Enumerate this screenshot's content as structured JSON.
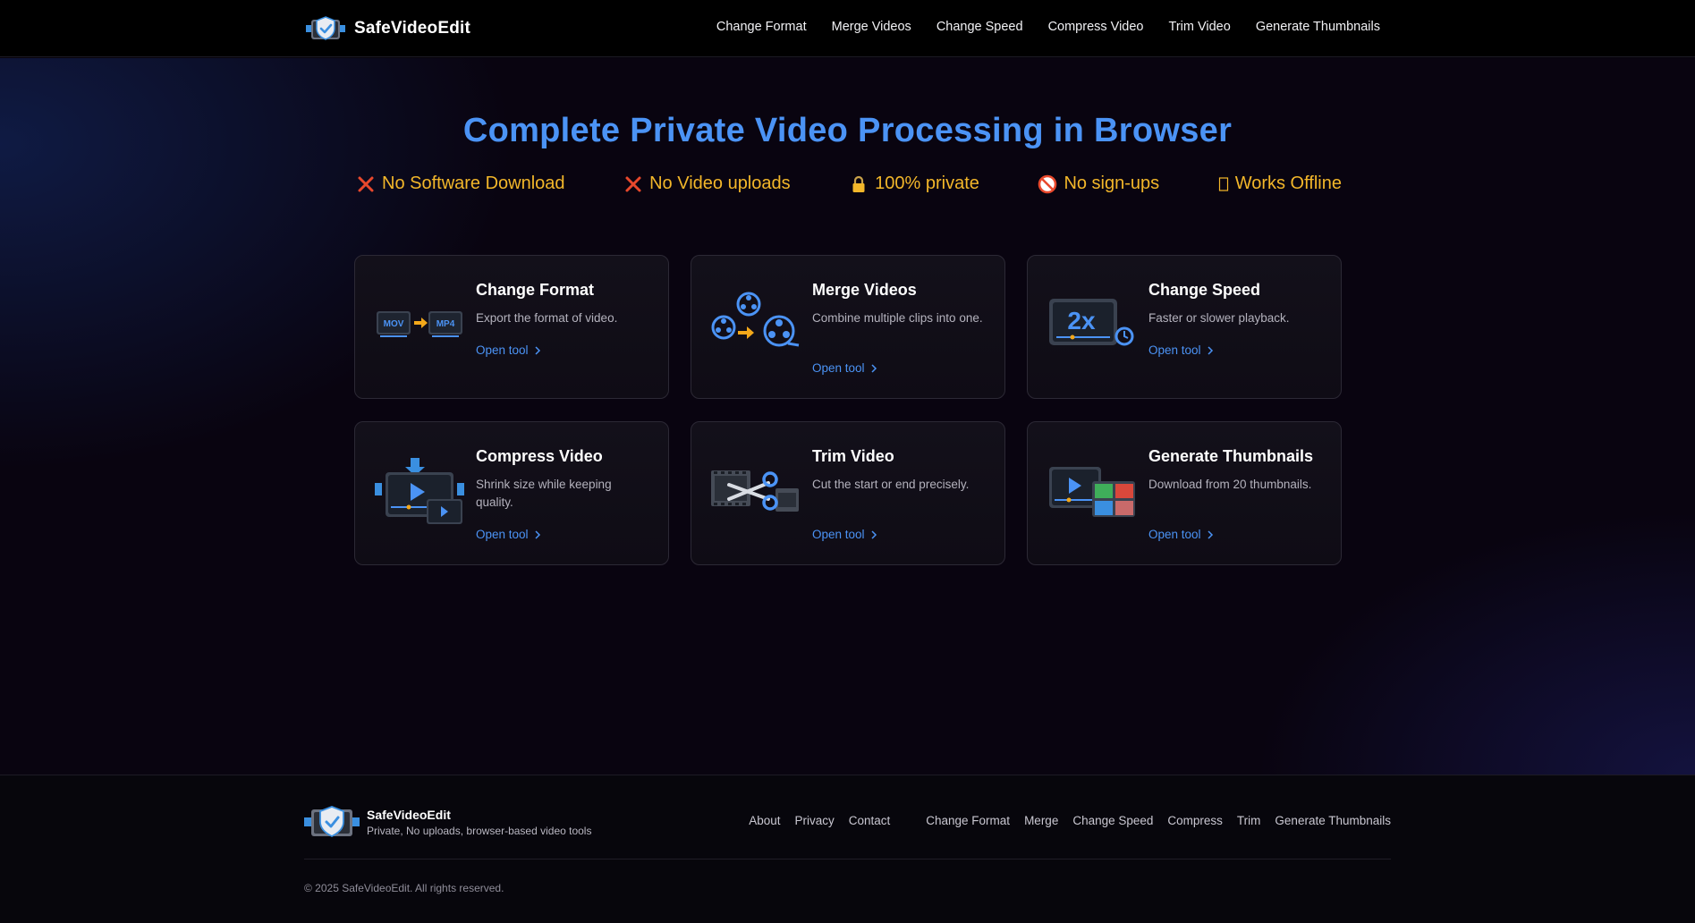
{
  "header": {
    "brand_name": "SafeVideoEdit",
    "nav": [
      {
        "label": "Change Format"
      },
      {
        "label": "Merge Videos"
      },
      {
        "label": "Change Speed"
      },
      {
        "label": "Compress Video"
      },
      {
        "label": "Trim Video"
      },
      {
        "label": "Generate Thumbnails"
      }
    ]
  },
  "hero": {
    "title": "Complete Private Video Processing in Browser",
    "features": [
      {
        "icon": "red-x-icon",
        "label": "No Software Download"
      },
      {
        "icon": "red-x-icon",
        "label": "No Video uploads"
      },
      {
        "icon": "lock-icon",
        "label": "100% private"
      },
      {
        "icon": "no-entry-icon",
        "label": "No sign-ups"
      },
      {
        "icon": "missing-glyph-icon",
        "label": "Works Offline"
      }
    ]
  },
  "tools": [
    {
      "title": "Change Format",
      "desc": "Export the format of video.",
      "link": "Open tool",
      "icon": "format-convert-icon",
      "mov": "MOV",
      "mp4": "MP4"
    },
    {
      "title": "Merge Videos",
      "desc": "Combine multiple clips into one.",
      "link": "Open tool",
      "icon": "film-reels-icon"
    },
    {
      "title": "Change Speed",
      "desc": "Faster or slower playback.",
      "link": "Open tool",
      "icon": "speed-2x-icon",
      "speed": "2x"
    },
    {
      "title": "Compress Video",
      "desc": "Shrink size while keeping quality.",
      "link": "Open tool",
      "icon": "compress-video-icon"
    },
    {
      "title": "Trim Video",
      "desc": "Cut the start or end precisely.",
      "link": "Open tool",
      "icon": "scissors-film-icon"
    },
    {
      "title": "Generate Thumbnails",
      "desc": "Download from 20 thumbnails.",
      "link": "Open tool",
      "icon": "thumbnails-icon"
    }
  ],
  "footer": {
    "brand_name": "SafeVideoEdit",
    "tagline": "Private, No uploads, browser-based video tools",
    "links_primary": [
      {
        "label": "About"
      },
      {
        "label": "Privacy"
      },
      {
        "label": "Contact"
      }
    ],
    "links_tools": [
      {
        "label": "Change Format"
      },
      {
        "label": "Merge"
      },
      {
        "label": "Change Speed"
      },
      {
        "label": "Compress"
      },
      {
        "label": "Trim"
      },
      {
        "label": "Generate Thumbnails"
      }
    ],
    "copyright": "© 2025 SafeVideoEdit. All rights reserved."
  },
  "colors": {
    "accent_blue": "#4b93f5",
    "feature_yellow": "#f3b72a",
    "cross_red": "#e8482c"
  }
}
